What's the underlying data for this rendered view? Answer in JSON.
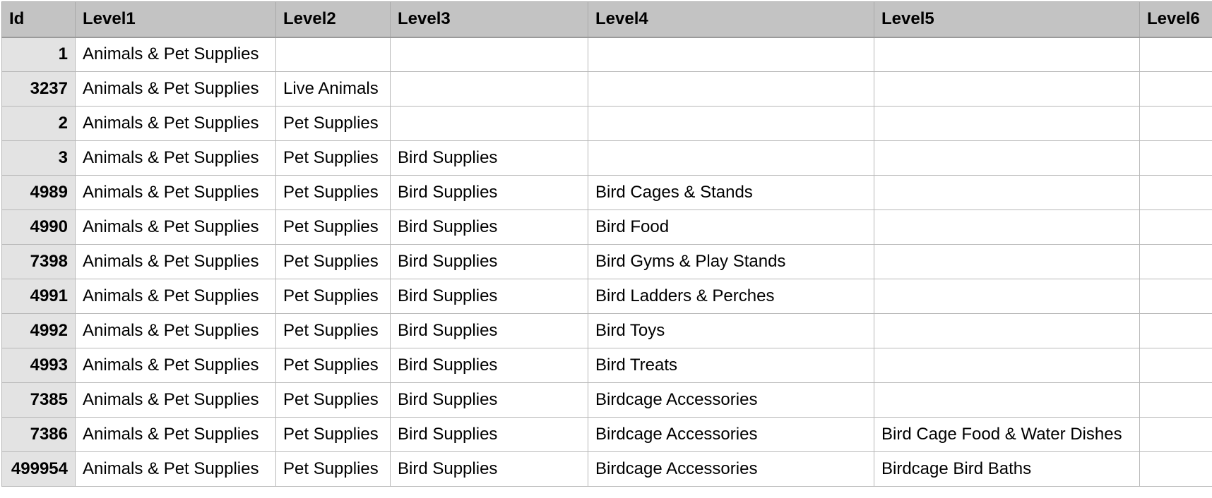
{
  "columns": [
    "Id",
    "Level1",
    "Level2",
    "Level3",
    "Level4",
    "Level5",
    "Level6"
  ],
  "rows": [
    [
      "1",
      "Animals & Pet Supplies",
      "",
      "",
      "",
      "",
      ""
    ],
    [
      "3237",
      "Animals & Pet Supplies",
      "Live Animals",
      "",
      "",
      "",
      ""
    ],
    [
      "2",
      "Animals & Pet Supplies",
      "Pet Supplies",
      "",
      "",
      "",
      ""
    ],
    [
      "3",
      "Animals & Pet Supplies",
      "Pet Supplies",
      "Bird Supplies",
      "",
      "",
      ""
    ],
    [
      "4989",
      "Animals & Pet Supplies",
      "Pet Supplies",
      "Bird Supplies",
      "Bird Cages & Stands",
      "",
      ""
    ],
    [
      "4990",
      "Animals & Pet Supplies",
      "Pet Supplies",
      "Bird Supplies",
      "Bird Food",
      "",
      ""
    ],
    [
      "7398",
      "Animals & Pet Supplies",
      "Pet Supplies",
      "Bird Supplies",
      "Bird Gyms & Play Stands",
      "",
      ""
    ],
    [
      "4991",
      "Animals & Pet Supplies",
      "Pet Supplies",
      "Bird Supplies",
      "Bird Ladders & Perches",
      "",
      ""
    ],
    [
      "4992",
      "Animals & Pet Supplies",
      "Pet Supplies",
      "Bird Supplies",
      "Bird Toys",
      "",
      ""
    ],
    [
      "4993",
      "Animals & Pet Supplies",
      "Pet Supplies",
      "Bird Supplies",
      "Bird Treats",
      "",
      ""
    ],
    [
      "7385",
      "Animals & Pet Supplies",
      "Pet Supplies",
      "Bird Supplies",
      "Birdcage Accessories",
      "",
      ""
    ],
    [
      "7386",
      "Animals & Pet Supplies",
      "Pet Supplies",
      "Bird Supplies",
      "Birdcage Accessories",
      "Bird Cage Food & Water Dishes",
      ""
    ],
    [
      "499954",
      "Animals & Pet Supplies",
      "Pet Supplies",
      "Bird Supplies",
      "Birdcage Accessories",
      "Birdcage Bird Baths",
      ""
    ]
  ]
}
